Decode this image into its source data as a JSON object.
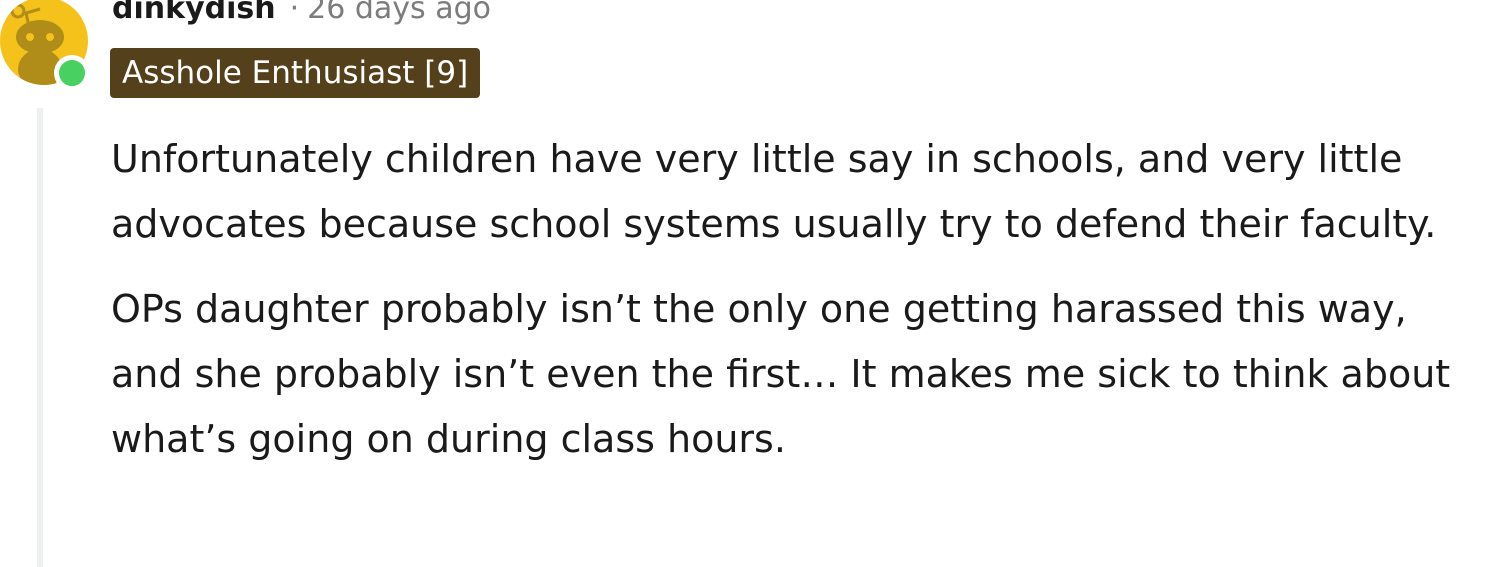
{
  "comment": {
    "username": "dinkydish",
    "separator": "·",
    "timestamp": "26 days ago",
    "flair": "Asshole Enthusiast [9]",
    "avatar_icon": "reddit-snoo-avatar",
    "online_status": "online",
    "paragraphs": [
      "Unfortunately children have very little say in schools, and very little advocates because school systems usually try to defend their faculty.",
      "OPs daughter probably isn’t the only one getting harassed this way, and she probably isn’t even the first… It makes me sick to think about what’s going on during class hours."
    ]
  },
  "colors": {
    "avatar_bg": "#f5c21b",
    "online": "#46d160",
    "flair_bg": "#54401a",
    "meta_text": "#7c7c7c",
    "thread_line": "#edeff1"
  }
}
